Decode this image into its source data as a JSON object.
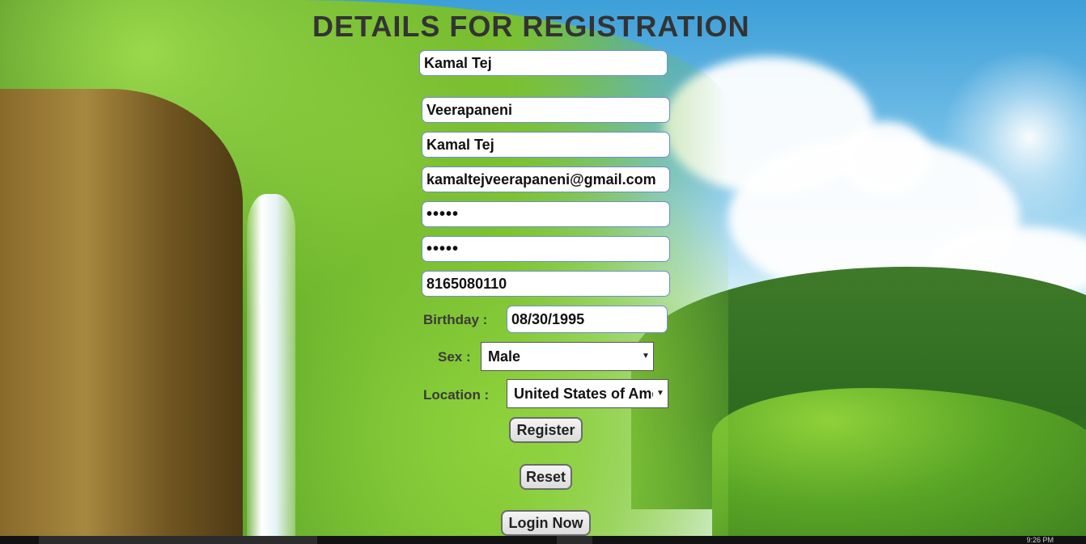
{
  "page": {
    "title": "DETAILS FOR REGISTRATION"
  },
  "form": {
    "first_name": "Kamal Tej",
    "last_name": "Veerapaneni",
    "username": "Kamal Tej",
    "email": "kamaltejveerapaneni@gmail.com",
    "password": "•••••",
    "confirm_password": "•••••",
    "phone": "8165080110",
    "birthday_label": "Birthday :",
    "birthday": "08/30/1995",
    "sex_label": "Sex :",
    "sex_selected": "Male",
    "location_label": "Location :",
    "location_selected": "United States of America",
    "register_label": "Register",
    "reset_label": "Reset",
    "login_label": "Login Now"
  },
  "taskbar": {
    "clock": "9:26 PM"
  },
  "icons": {
    "dropdown": "chevron-down-icon"
  },
  "colors": {
    "title": "#333333",
    "field_border": "#6d8fc9",
    "button_border": "#6b6b6b"
  }
}
